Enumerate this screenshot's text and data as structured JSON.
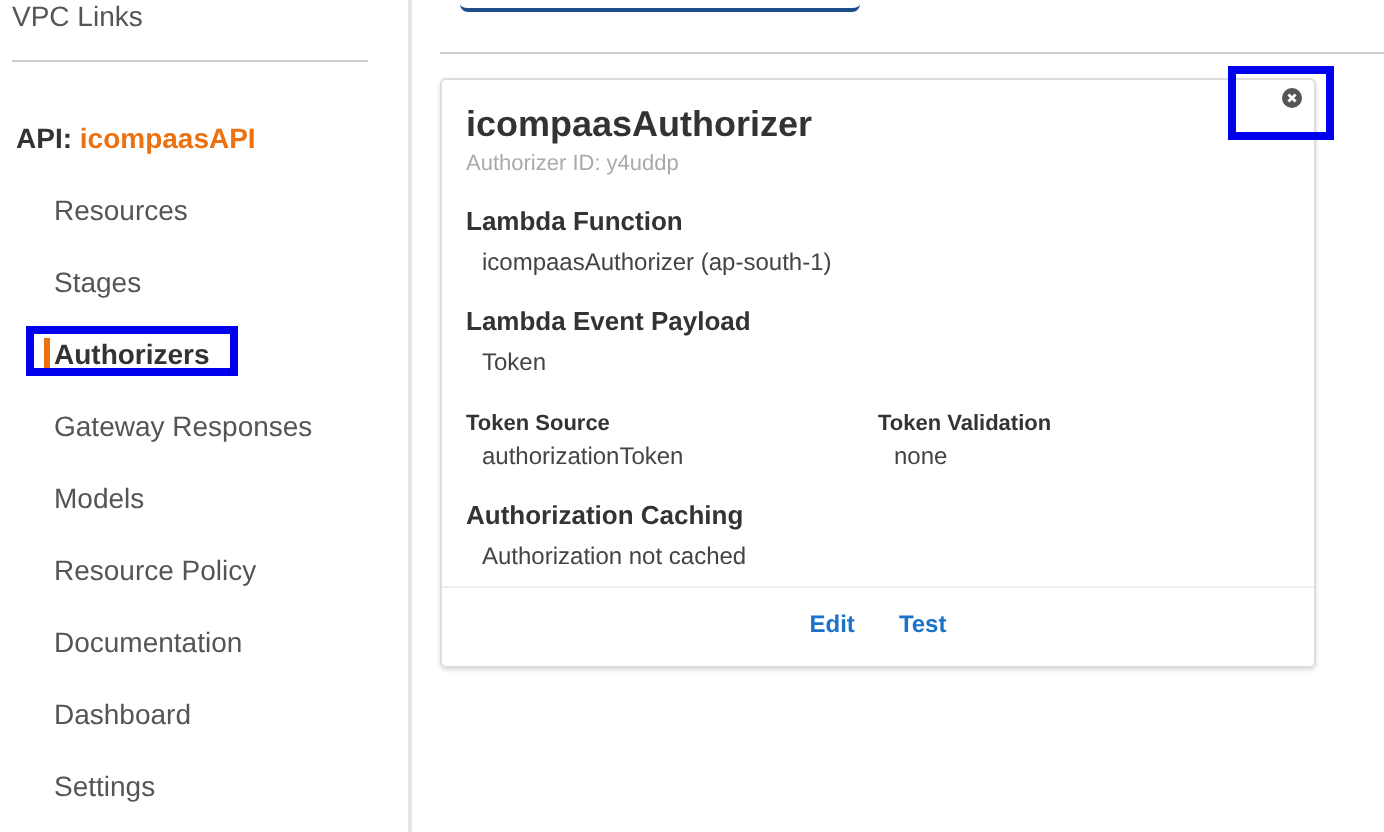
{
  "sidebar": {
    "top_item": "VPC Links",
    "api_label": "API:",
    "api_name": "icompaasAPI",
    "items": [
      {
        "label": "Resources",
        "selected": false,
        "highlighted": false
      },
      {
        "label": "Stages",
        "selected": false,
        "highlighted": false
      },
      {
        "label": "Authorizers",
        "selected": true,
        "highlighted": true
      },
      {
        "label": "Gateway Responses",
        "selected": false,
        "highlighted": false
      },
      {
        "label": "Models",
        "selected": false,
        "highlighted": false
      },
      {
        "label": "Resource Policy",
        "selected": false,
        "highlighted": false
      },
      {
        "label": "Documentation",
        "selected": false,
        "highlighted": false
      },
      {
        "label": "Dashboard",
        "selected": false,
        "highlighted": false
      },
      {
        "label": "Settings",
        "selected": false,
        "highlighted": false
      }
    ]
  },
  "card": {
    "title": "icompaasAuthorizer",
    "subtitle": "Authorizer ID: y4uddp",
    "close_highlighted": true,
    "sections": [
      {
        "heading": "Lambda Function",
        "value": "icompaasAuthorizer (ap-south-1)"
      },
      {
        "heading": "Lambda Event Payload",
        "value": "Token"
      }
    ],
    "pairs": [
      {
        "heading": "Token Source",
        "value": "authorizationToken"
      },
      {
        "heading": "Token Validation",
        "value": "none"
      }
    ],
    "caching": {
      "heading": "Authorization Caching",
      "value": "Authorization not cached"
    },
    "actions": [
      "Edit",
      "Test"
    ]
  }
}
